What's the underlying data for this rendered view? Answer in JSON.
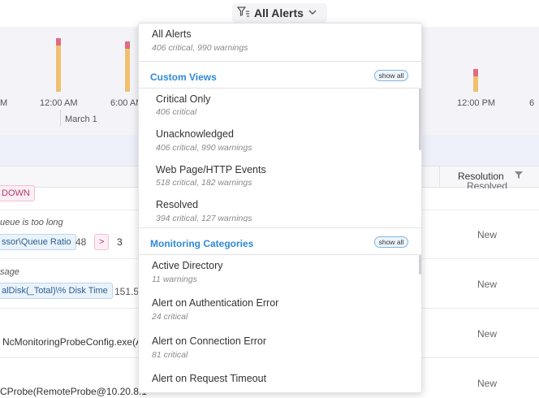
{
  "header": {
    "filter_label": "All Alerts",
    "filter_icon": "funnel-sort-icon",
    "chevron_icon": "chevron-down-icon"
  },
  "chart": {
    "tick_labels": [
      "M",
      "12:00 AM",
      "6:00 AM",
      "12:00 PM",
      "6"
    ],
    "date_label": "March 1",
    "colors": {
      "warning": "#f0c070",
      "critical": "#e06b85"
    }
  },
  "table": {
    "resolution_header": "Resolution",
    "filter_icon": "funnel-icon",
    "rows": [
      {
        "tag": "DOWN",
        "status_partial": "Resolved"
      },
      {
        "desc": "ueue is too long",
        "metric": "ssor\\Queue Ratio",
        "value": "48",
        "operator": ">",
        "threshold": "3",
        "status": "New"
      },
      {
        "desc": "sage",
        "metric": "alDisk(_Total)\\% Disk Time",
        "value": "151.5",
        "status": "New"
      },
      {
        "source": "NcMonitoringProbeConfig.exe(A",
        "status": "New"
      },
      {
        "source": "CProbe(RemoteProbe@10.20.8.1",
        "status": "New"
      }
    ]
  },
  "dropdown": {
    "all_alerts": {
      "title": "All Alerts",
      "subtitle": "406 critical, 990 warnings"
    },
    "custom_views": {
      "title": "Custom Views",
      "show_all": "show all",
      "items": [
        {
          "title": "Critical Only",
          "subtitle": "406 critical"
        },
        {
          "title": "Unacknowledged",
          "subtitle": "406 critical, 990 warnings"
        },
        {
          "title": "Web Page/HTTP Events",
          "subtitle": "518 critical, 182 warnings"
        },
        {
          "title": "Resolved",
          "subtitle": "394 critical, 127 warnings"
        }
      ]
    },
    "monitoring_categories": {
      "title": "Monitoring Categories",
      "show_all": "show all",
      "items": [
        {
          "title": "Active Directory",
          "subtitle": "11 warnings"
        },
        {
          "title": "Alert on Authentication Error",
          "subtitle": "24 critical"
        },
        {
          "title": "Alert on Connection Error",
          "subtitle": "81 critical"
        },
        {
          "title": "Alert on Request Timeout",
          "subtitle": ""
        }
      ]
    }
  }
}
